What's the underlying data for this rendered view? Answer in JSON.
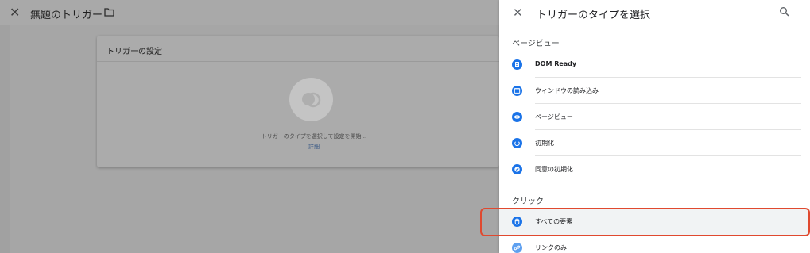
{
  "editor": {
    "title": "無題のトリガー",
    "card_title": "トリガーの設定",
    "choose_text": "トリガーのタイプを選択して設定を開始...",
    "details_link": "詳細"
  },
  "picker": {
    "title": "トリガーのタイプを選択",
    "sections": [
      {
        "label": "ページビュー",
        "items": [
          {
            "label": "DOM Ready",
            "icon": "document-icon"
          },
          {
            "label": "ウィンドウの読み込み",
            "icon": "window-icon"
          },
          {
            "label": "ページビュー",
            "icon": "eye-icon"
          },
          {
            "label": "初期化",
            "icon": "power-icon"
          },
          {
            "label": "同意の初期化",
            "icon": "consent-icon"
          }
        ]
      },
      {
        "label": "クリック",
        "items": [
          {
            "label": "すべての要素",
            "icon": "cursor-icon",
            "highlighted": true
          },
          {
            "label": "リンクのみ",
            "icon": "link-icon"
          }
        ]
      }
    ]
  },
  "colors": {
    "accent_blue": "#1a73e8",
    "highlight_red": "#e0492f"
  }
}
